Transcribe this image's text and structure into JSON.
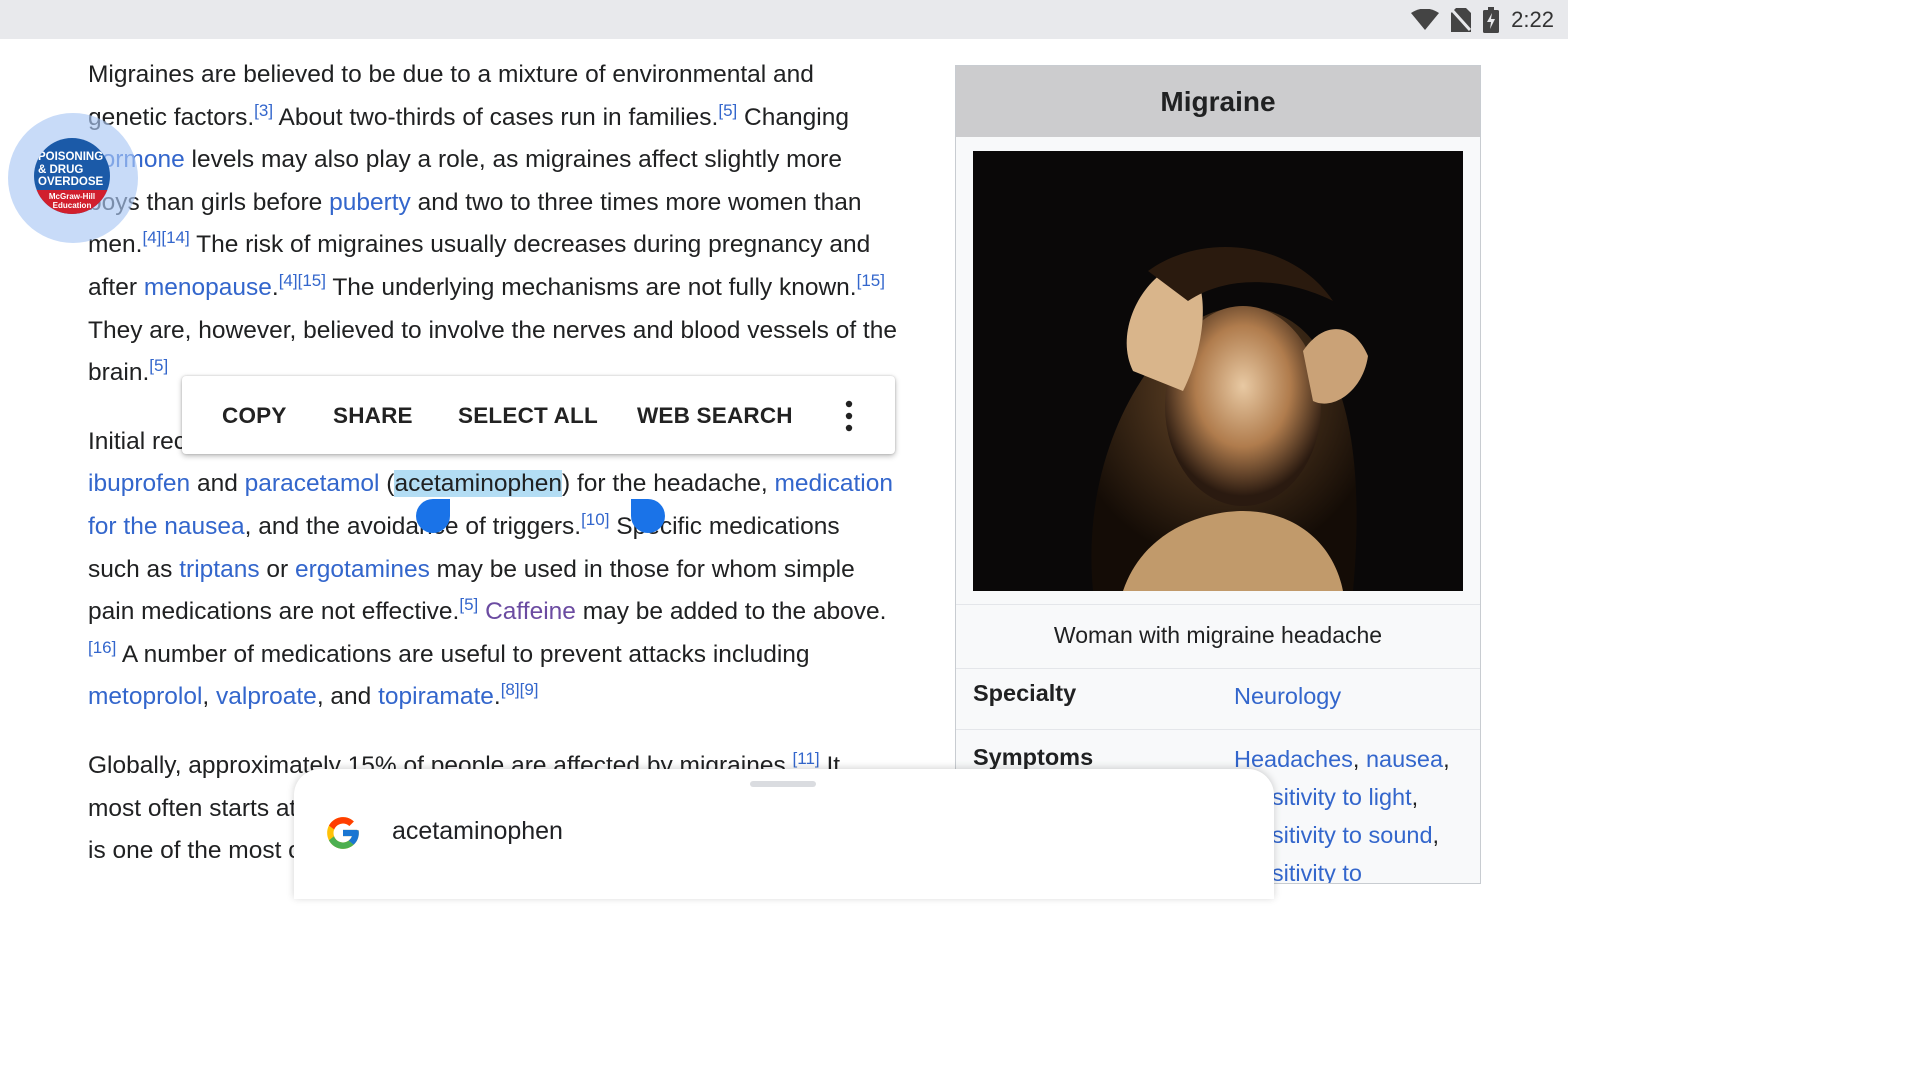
{
  "status_bar": {
    "time": "2:22",
    "icons": [
      "wifi-icon",
      "no-sim-icon",
      "battery-charging-icon"
    ]
  },
  "article": {
    "paragraph1": [
      {
        "t": "Migraines are believed to be due to a mixture of environmental and genetic factors."
      },
      {
        "sup": "[3]"
      },
      {
        "t": " About two-thirds of cases run in families."
      },
      {
        "sup": "[5]"
      },
      {
        "t": " Changing "
      },
      {
        "link": "hormone"
      },
      {
        "t": " levels may also play a role, as migraines affect slightly more boys than girls before "
      },
      {
        "link": "puberty"
      },
      {
        "t": " and two to three times more women than men."
      },
      {
        "sup": "[4][14]"
      },
      {
        "t": " The risk of migraines usually decreases during pregnancy and after "
      },
      {
        "link": "menopause"
      },
      {
        "t": "."
      },
      {
        "sup": "[4][15]"
      },
      {
        "t": " The underlying mechanisms are not fully known."
      },
      {
        "sup": "[15]"
      },
      {
        "t": " They are, however, believed to involve the nerves and blood vessels of the brain."
      },
      {
        "sup": "[5]"
      }
    ],
    "paragraph2": [
      {
        "t": "Initial recommended management is with simple pain medications such as "
      },
      {
        "link": "ibuprofen"
      },
      {
        "t": " and "
      },
      {
        "link": "paracetamol"
      },
      {
        "t": " ("
      },
      {
        "sel": "acetaminophen"
      },
      {
        "t": ") for the headache, "
      },
      {
        "link": "medication for the nausea"
      },
      {
        "t": ", and the avoidance of triggers."
      },
      {
        "sup": "[10]"
      },
      {
        "t": " Specific medications such as "
      },
      {
        "link": "triptans"
      },
      {
        "t": " or "
      },
      {
        "link": "ergotamines"
      },
      {
        "t": " may be used in those for whom simple pain medications are not effective."
      },
      {
        "sup": "[5]"
      },
      {
        "t": " "
      },
      {
        "visited": "Caffeine"
      },
      {
        "t": " may be added to the above."
      },
      {
        "sup": "[16]"
      },
      {
        "t": " A number of medications are useful to prevent attacks including "
      },
      {
        "link": "metoprolol"
      },
      {
        "t": ", "
      },
      {
        "link": "valproate"
      },
      {
        "t": ", and "
      },
      {
        "link": "topiramate"
      },
      {
        "t": "."
      },
      {
        "sup": "[8][9]"
      }
    ],
    "paragraph3": [
      {
        "t": "Globally, approximately 15% of people are affected by migraines."
      },
      {
        "sup": "[11]"
      },
      {
        "t": " It most often starts at puberty and is worst during middle age. As of 2016, it is one of the most common causes of disability."
      }
    ]
  },
  "context_menu": {
    "copy": "COPY",
    "share": "SHARE",
    "select_all": "SELECT ALL",
    "web_search": "WEB SEARCH"
  },
  "bubble": {
    "line1": "POISONING",
    "line2": "& DRUG",
    "line3": "OVERDOSE",
    "publisher1": "McGraw-Hill",
    "publisher2": "Education"
  },
  "infobox": {
    "title": "Migraine",
    "caption": "Woman with migraine headache",
    "rows": [
      {
        "label": "Specialty",
        "values": [
          "Neurology"
        ]
      },
      {
        "label": "Symptoms",
        "values": [
          "Headaches",
          "nausea",
          "sensitivity to light",
          "sensitivity to sound",
          "sensitivity to"
        ]
      }
    ]
  },
  "search_sheet": {
    "query": "acetaminophen"
  },
  "colors": {
    "link": "#3366cc",
    "visited": "#6b4ba1",
    "selection": "#b3ddf4",
    "handle": "#1a73e8",
    "infobox_title_bg": "#ccccce"
  }
}
